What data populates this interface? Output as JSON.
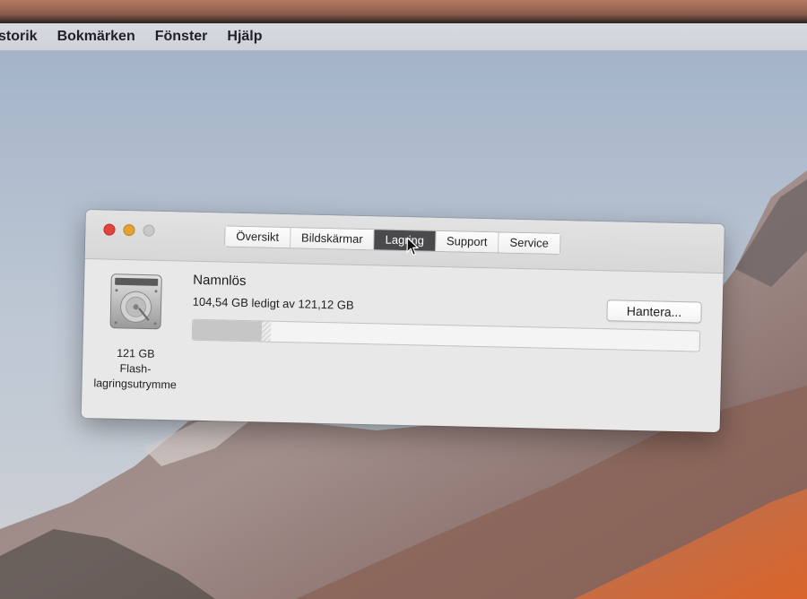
{
  "menubar": {
    "items": [
      "storik",
      "Bokmärken",
      "Fönster",
      "Hjälp"
    ]
  },
  "window": {
    "tabs": [
      {
        "label": "Översikt",
        "active": false
      },
      {
        "label": "Bildskärmar",
        "active": false
      },
      {
        "label": "Lagring",
        "active": true
      },
      {
        "label": "Support",
        "active": false
      },
      {
        "label": "Service",
        "active": false
      }
    ],
    "disk": {
      "icon": "hard-drive-icon",
      "capacity_label": "121 GB",
      "type_line1": "Flash-",
      "type_line2": "lagringsutrymme"
    },
    "volume": {
      "name": "Namnlös",
      "free_text": "104,54 GB ledigt av 121,12 GB",
      "used_fraction": 0.137
    },
    "manage_button": "Hantera..."
  },
  "colors": {
    "close": "#e0443e",
    "minimize": "#dea236",
    "zoom": "#c9c8c8",
    "active_tab": "#4a4a4c"
  }
}
